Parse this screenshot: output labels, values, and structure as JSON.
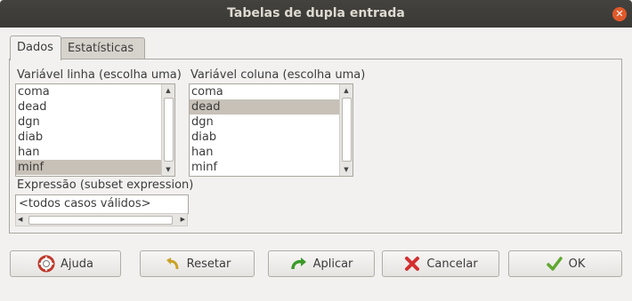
{
  "window": {
    "title": "Tabelas de dupla entrada"
  },
  "tabs": [
    {
      "label": "Dados",
      "active": true
    },
    {
      "label": "Estatísticas",
      "active": false
    }
  ],
  "row_variable": {
    "label": "Variável linha (escolha uma)",
    "items": [
      "coma",
      "dead",
      "dgn",
      "diab",
      "han",
      "minf"
    ],
    "selected": "minf"
  },
  "column_variable": {
    "label": "Variável coluna (escolha uma)",
    "items": [
      "coma",
      "dead",
      "dgn",
      "diab",
      "han",
      "minf"
    ],
    "selected": "dead"
  },
  "subset": {
    "label": "Expressão (subset expression)",
    "value": "<todos casos válidos>"
  },
  "buttons": {
    "help": "Ajuda",
    "reset": "Resetar",
    "apply": "Aplicar",
    "cancel": "Cancelar",
    "ok": "OK"
  },
  "colors": {
    "selection": "#c7c1b8",
    "titlebar": "#3c3b37",
    "close": "#e0592a"
  }
}
